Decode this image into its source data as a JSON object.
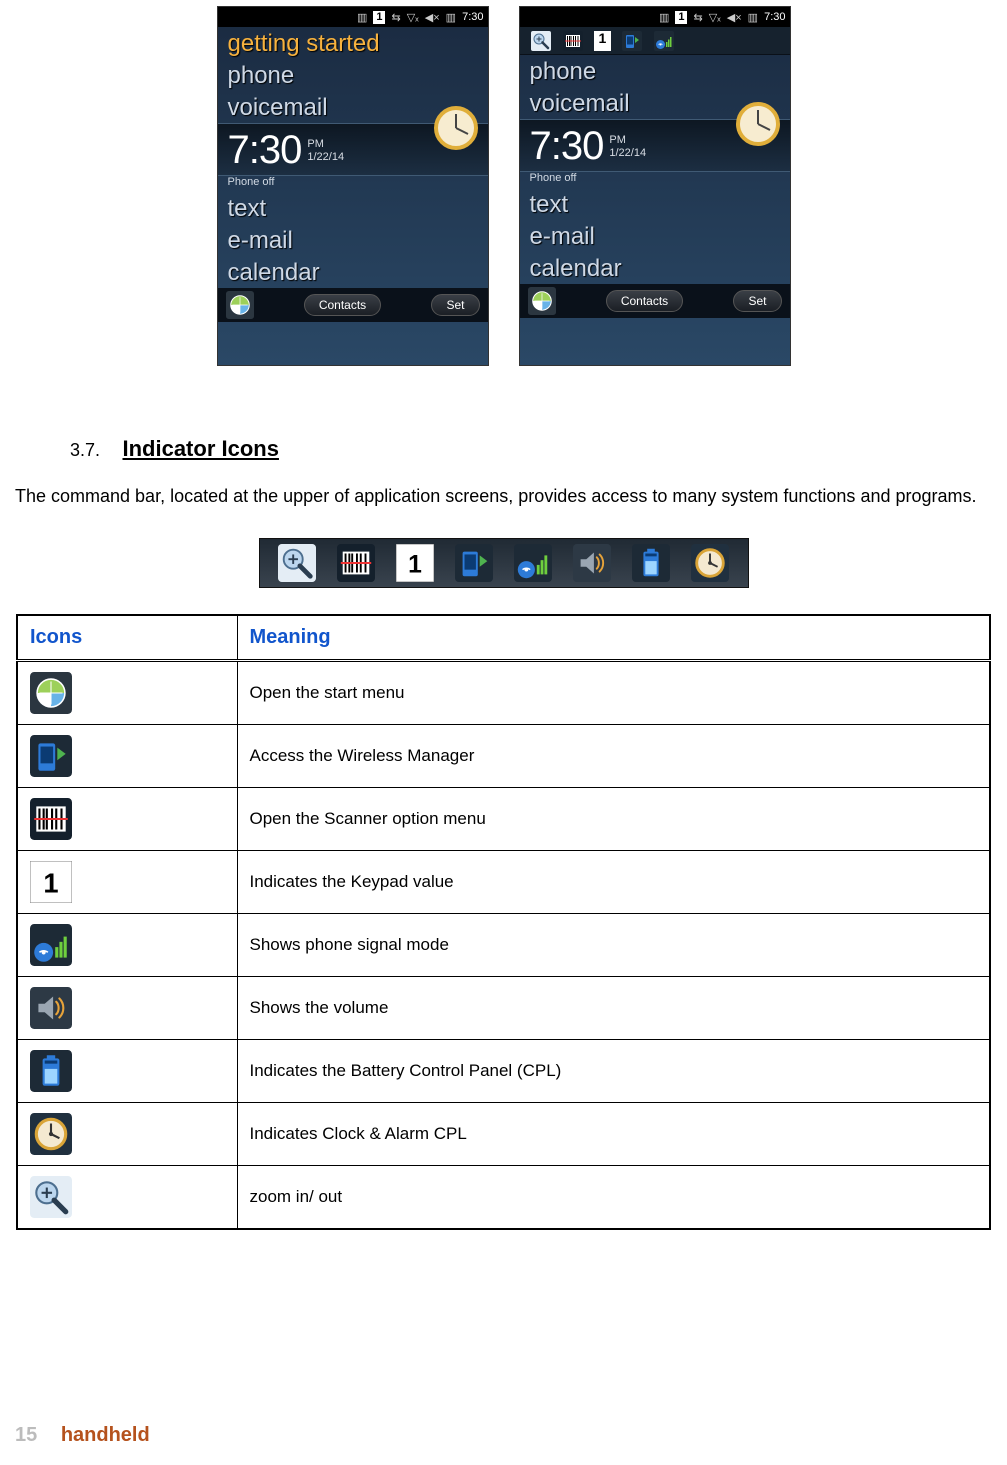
{
  "screenshots": {
    "status_time": "7:30",
    "status_keypad": "1",
    "left_first_row_label": "getting started",
    "menu": [
      "phone",
      "voicemail"
    ],
    "clock_time": "7:30",
    "clock_ampm": "PM",
    "clock_date": "1/22/14",
    "phone_status": "Phone off",
    "menu_after": [
      "text",
      "e-mail",
      "calendar"
    ],
    "soft_left": "Contacts",
    "soft_right": "Set"
  },
  "section": {
    "number": "3.7.",
    "title": "Indicator Icons",
    "body": "The command bar, located at the upper of application screens, provides access to many system functions and programs."
  },
  "table": {
    "head_icons": "Icons",
    "head_meaning": "Meaning",
    "rows": [
      {
        "icon": "start",
        "text": "Open the start menu"
      },
      {
        "icon": "wireless",
        "text": "Access the Wireless Manager"
      },
      {
        "icon": "scanner",
        "text": "Open the Scanner option menu"
      },
      {
        "icon": "keypad",
        "text": "Indicates the Keypad value"
      },
      {
        "icon": "signal",
        "text": "Shows phone signal mode"
      },
      {
        "icon": "volume",
        "text": "Shows the volume"
      },
      {
        "icon": "battery",
        "text": "Indicates the Battery Control Panel (CPL)"
      },
      {
        "icon": "clock",
        "text": "Indicates Clock & Alarm CPL"
      },
      {
        "icon": "zoom",
        "text": "zoom in/ out"
      }
    ]
  },
  "iconstrip_order": [
    "zoom",
    "scanner",
    "keypad",
    "wireless",
    "signal",
    "volume",
    "battery",
    "clock"
  ],
  "footer": {
    "page": "15",
    "brand": "handheld"
  }
}
